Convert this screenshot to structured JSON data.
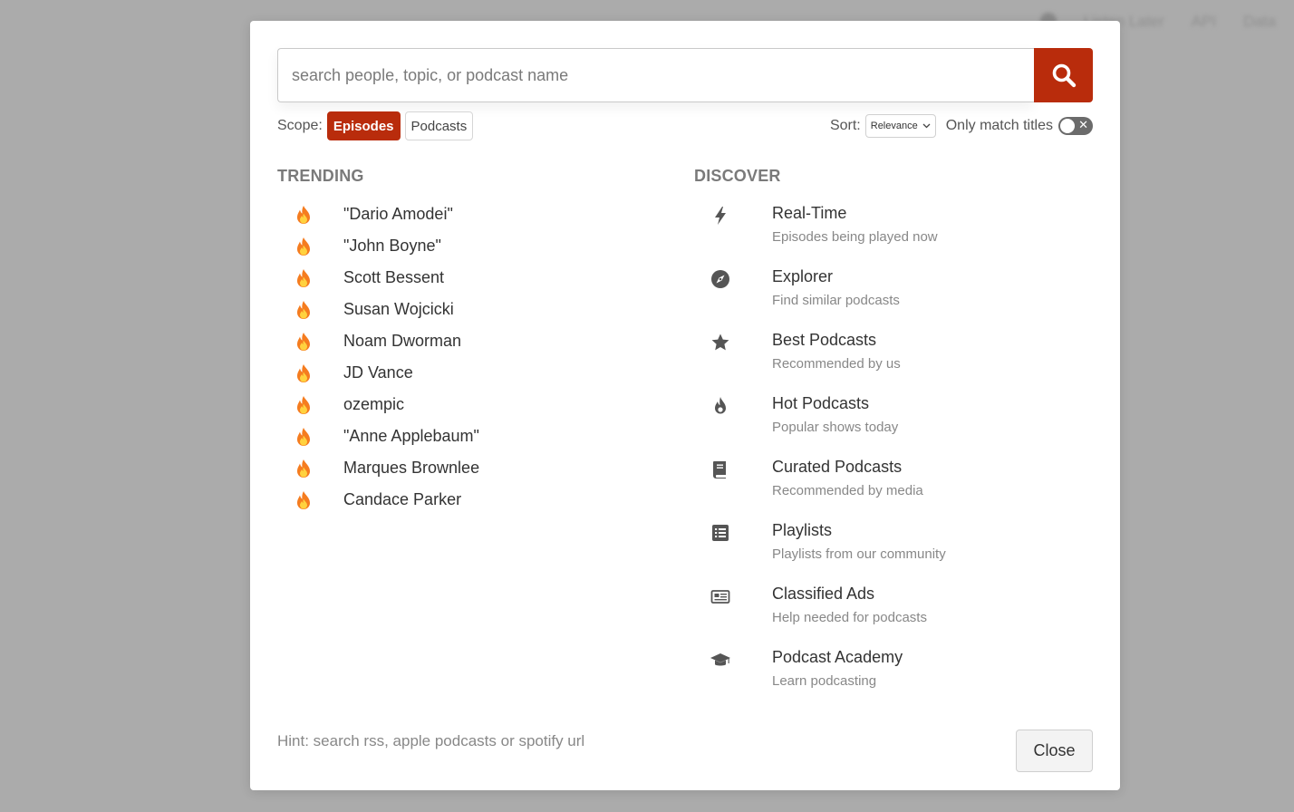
{
  "background_nav": [
    "Listen Later",
    "API",
    "Data"
  ],
  "search": {
    "placeholder": "search people, topic, or podcast name",
    "value": ""
  },
  "scope": {
    "label": "Scope:",
    "options": [
      "Episodes",
      "Podcasts"
    ],
    "selected": "Episodes"
  },
  "sort": {
    "label": "Sort:",
    "selected": "Relevance"
  },
  "only_match_titles": {
    "label": "Only match titles",
    "enabled": false
  },
  "trending": {
    "title": "TRENDING",
    "items": [
      "\"Dario Amodei\"",
      "\"John Boyne\"",
      "Scott Bessent",
      "Susan Wojcicki",
      "Noam Dworman",
      "JD Vance",
      "ozempic",
      "\"Anne Applebaum\"",
      "Marques Brownlee",
      "Candace Parker"
    ]
  },
  "discover": {
    "title": "DISCOVER",
    "items": [
      {
        "icon": "bolt-icon",
        "title": "Real-Time",
        "subtitle": "Episodes being played now"
      },
      {
        "icon": "compass-icon",
        "title": "Explorer",
        "subtitle": "Find similar podcasts"
      },
      {
        "icon": "star-icon",
        "title": "Best Podcasts",
        "subtitle": "Recommended by us"
      },
      {
        "icon": "flame-icon",
        "title": "Hot Podcasts",
        "subtitle": "Popular shows today"
      },
      {
        "icon": "book-icon",
        "title": "Curated Podcasts",
        "subtitle": "Recommended by media"
      },
      {
        "icon": "list-icon",
        "title": "Playlists",
        "subtitle": "Playlists from our community"
      },
      {
        "icon": "newspaper-icon",
        "title": "Classified Ads",
        "subtitle": "Help needed for podcasts"
      },
      {
        "icon": "graduation-cap-icon",
        "title": "Podcast Academy",
        "subtitle": "Learn podcasting"
      }
    ]
  },
  "hint": "Hint: search rss, apple podcasts or spotify url",
  "close_label": "Close",
  "colors": {
    "accent": "#b92c0c",
    "backdrop": "#ababab",
    "icon_gray": "#555555"
  }
}
